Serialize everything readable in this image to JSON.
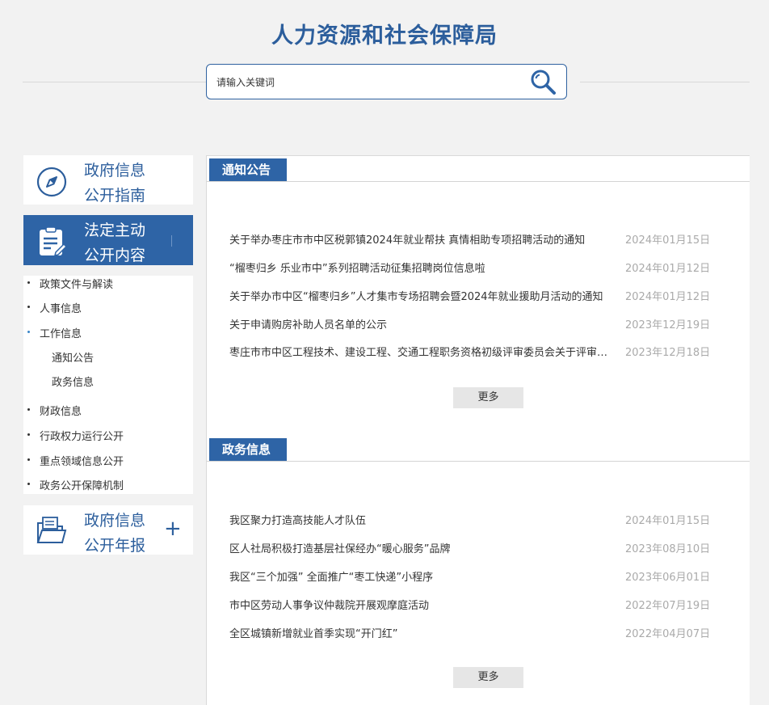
{
  "header": {
    "title": "人力资源和社会保障局"
  },
  "search": {
    "placeholder": "请输入关键词"
  },
  "sidebar": {
    "guide": {
      "line1": "政府信息",
      "line2": "公开指南"
    },
    "active": {
      "line1": "法定主动",
      "line2": "公开内容"
    },
    "menu": [
      {
        "label": "政策文件与解读"
      },
      {
        "label": "人事信息"
      },
      {
        "label": "工作信息"
      },
      {
        "label": "财政信息"
      },
      {
        "label": "行政权力运行公开"
      },
      {
        "label": "重点领域信息公开"
      },
      {
        "label": "政务公开保障机制"
      }
    ],
    "submenu": [
      {
        "label": "通知公告"
      },
      {
        "label": "政务信息"
      }
    ],
    "annual": {
      "line1": "政府信息",
      "line2": "公开年报",
      "plus": "+"
    }
  },
  "notices": {
    "heading": "通知公告",
    "more": "更多",
    "items": [
      {
        "title": "关于举办枣庄市市中区税郭镇2024年就业帮扶 真情相助专项招聘活动的通知",
        "date": "2024年01月15日"
      },
      {
        "title": "“榴枣归乡 乐业市中”系列招聘活动征集招聘岗位信息啦",
        "date": "2024年01月12日"
      },
      {
        "title": "关于举办市中区“榴枣归乡”人才集市专场招聘会暨2024年就业援助月活动的通知",
        "date": "2024年01月12日"
      },
      {
        "title": "关于申请购房补助人员名单的公示",
        "date": "2023年12月19日"
      },
      {
        "title": "枣庄市市中区工程技术、建设工程、交通工程职务资格初级评审委员会关于评审结果的公示",
        "date": "2023年12月18日"
      }
    ]
  },
  "affairs": {
    "heading": "政务信息",
    "more": "更多",
    "items": [
      {
        "title": "我区聚力打造高技能人才队伍",
        "date": "2024年01月15日"
      },
      {
        "title": "区人社局积极打造基层社保经办“暖心服务”品牌",
        "date": "2023年08月10日"
      },
      {
        "title": "我区“三个加强” 全面推广“枣工快递”小程序",
        "date": "2023年06月01日"
      },
      {
        "title": "市中区劳动人事争议仲裁院开展观摩庭活动",
        "date": "2022年07月19日"
      },
      {
        "title": "全区城镇新增就业首季实现“开门红”",
        "date": "2022年04月07日"
      }
    ]
  },
  "colors": {
    "brand": "#2e64a6",
    "title": "#2c5e9c",
    "date": "#aaaaaa",
    "background": "#f2f2f2"
  }
}
